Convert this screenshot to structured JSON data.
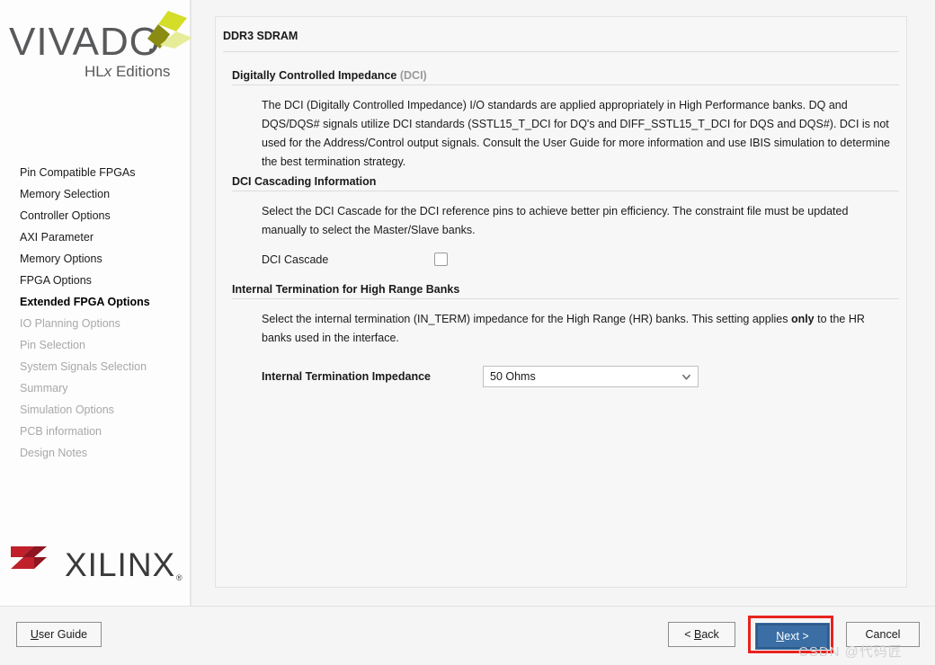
{
  "sidebar": {
    "product_name": "VIVADO",
    "product_edition_prefix": "HL",
    "product_edition_italic": "x",
    "product_edition_suffix": " Editions",
    "vendor_name": "XILINX",
    "vendor_trademark": "®",
    "items": [
      {
        "label": "Pin Compatible FPGAs",
        "state": "enabled"
      },
      {
        "label": "Memory Selection",
        "state": "enabled"
      },
      {
        "label": "Controller Options",
        "state": "enabled"
      },
      {
        "label": "AXI Parameter",
        "state": "enabled"
      },
      {
        "label": "Memory Options",
        "state": "enabled"
      },
      {
        "label": "FPGA Options",
        "state": "enabled"
      },
      {
        "label": "Extended FPGA Options",
        "state": "current"
      },
      {
        "label": "IO Planning Options",
        "state": "disabled"
      },
      {
        "label": "Pin Selection",
        "state": "disabled"
      },
      {
        "label": "System Signals Selection",
        "state": "disabled"
      },
      {
        "label": "Summary",
        "state": "disabled"
      },
      {
        "label": "Simulation Options",
        "state": "disabled"
      },
      {
        "label": "PCB information",
        "state": "disabled"
      },
      {
        "label": "Design Notes",
        "state": "disabled"
      }
    ]
  },
  "panel": {
    "title": "DDR3 SDRAM",
    "dci": {
      "heading": "Digitally Controlled Impedance",
      "heading_suffix": "(DCI)",
      "body": "The DCI (Digitally Controlled Impedance) I/O standards are applied appropriately in High Performance banks. DQ and DQS/DQS# signals utilize DCI standards (SSTL15_T_DCI for DQ's and DIFF_SSTL15_T_DCI for DQS and DQS#). DCI is not used for the Address/Control output signals. Consult the User Guide for more information and use IBIS simulation to determine the best termination strategy."
    },
    "cascading": {
      "heading": "DCI Cascading Information",
      "body": "Select the DCI Cascade for the DCI reference pins to achieve better pin efficiency. The constraint file must be updated manually to select the Master/Slave banks.",
      "checkbox_label": "DCI Cascade",
      "checkbox_checked": false
    },
    "termination": {
      "heading": "Internal Termination for High Range Banks",
      "body_part1": "Select the internal termination (IN_TERM) impedance for the High Range (HR) banks. This setting applies ",
      "body_emphasis": "only",
      "body_part2": " to the HR banks used in the interface.",
      "field_label": "Internal Termination Impedance",
      "field_value": "50 Ohms",
      "chevron_icon": "chevron-down-icon"
    }
  },
  "footer": {
    "user_guide": {
      "mnemonic": "U",
      "rest": "ser Guide"
    },
    "back": {
      "prefix": "< ",
      "mnemonic": "B",
      "rest": "ack"
    },
    "next": {
      "mnemonic": "N",
      "rest": "ext >"
    },
    "cancel": "Cancel"
  },
  "watermark": "CSDN @代码匠",
  "colors": {
    "accent_blue": "#3a6ea5",
    "highlight_red": "#e8231e",
    "xilinx_red": "#c0202a",
    "vivado_gray": "#58595b",
    "vivado_green_bright": "#d4dd28",
    "vivado_green_dark": "#8a8c12",
    "vivado_green_pale": "#e7ec9a"
  }
}
